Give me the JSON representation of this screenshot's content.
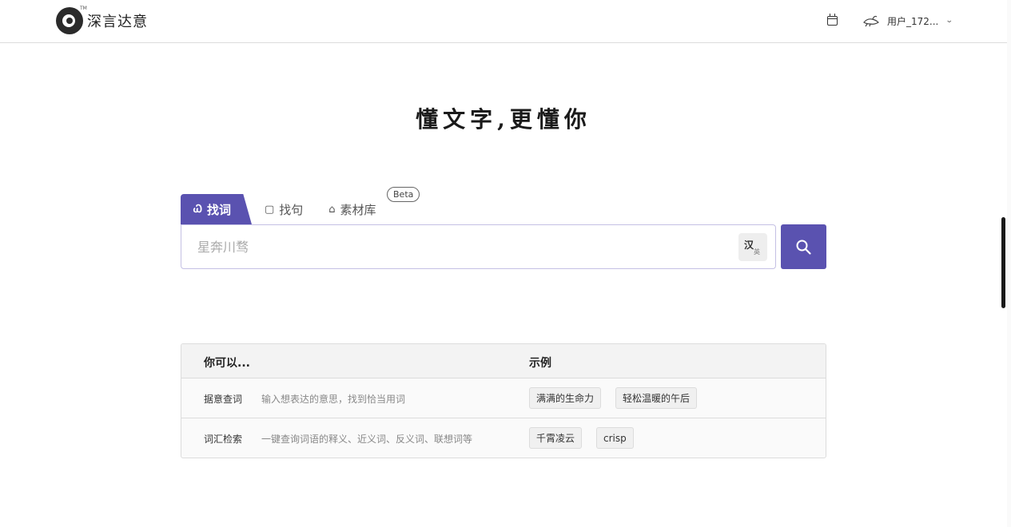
{
  "header": {
    "logo_text": "深言达意",
    "logo_tm": "TM",
    "user_name": "用户_172...",
    "icons": [
      "calendar-icon",
      "user-avatar-icon",
      "chevron-down-icon"
    ]
  },
  "hero": {
    "slogan": "懂文字,更懂你"
  },
  "tabs": [
    {
      "label": "找词",
      "icon": "Ꮗ",
      "active": true
    },
    {
      "label": "找句",
      "icon": "▢",
      "active": false
    },
    {
      "label": "素材库",
      "icon": "⌂",
      "active": false,
      "badge": "Beta"
    }
  ],
  "search": {
    "placeholder": "星奔川骛",
    "lang_toggle_primary": "汉",
    "lang_toggle_secondary": "英"
  },
  "table": {
    "header_left": "你可以...",
    "header_right": "示例",
    "rows": [
      {
        "name": "据意查词",
        "desc": "输入想表达的意思，找到恰当用词",
        "examples": [
          "满满的生命力",
          "轻松温暖的午后"
        ]
      },
      {
        "name": "词汇检索",
        "desc": "一键查询词语的释义、近义词、反义词、联想词等",
        "examples": [
          "千霄凌云",
          "crisp"
        ]
      }
    ]
  },
  "colors": {
    "accent": "#5a52b0",
    "border": "#dcdcdc",
    "text": "#222222"
  }
}
